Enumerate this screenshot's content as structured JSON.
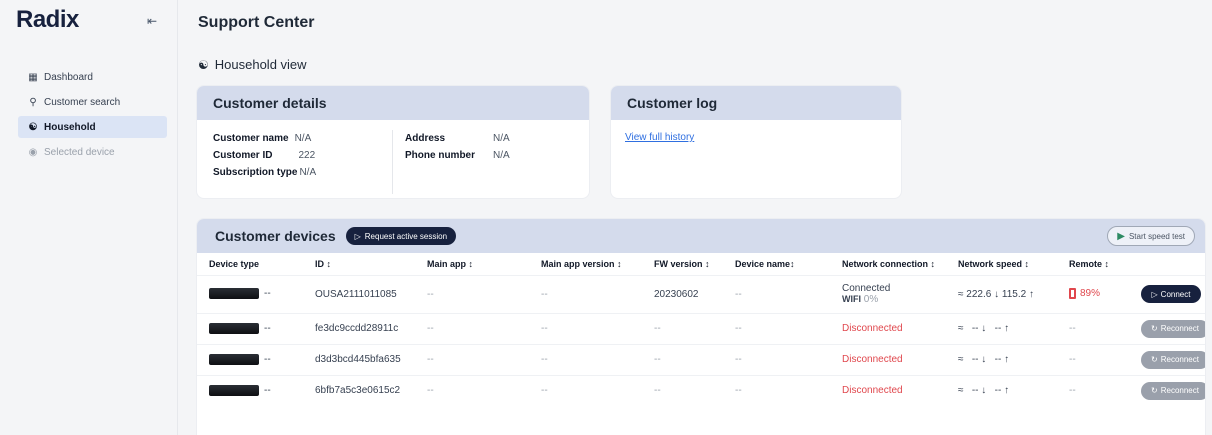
{
  "brand": "Radix",
  "sidebar": {
    "items": [
      {
        "label": "Dashboard",
        "icon": "grid-icon"
      },
      {
        "label": "Customer search",
        "icon": "search-icon"
      },
      {
        "label": "Household",
        "icon": "household-icon",
        "active": true
      },
      {
        "label": "Selected device",
        "icon": "device-icon",
        "disabled": true
      }
    ]
  },
  "header": {
    "title": "Support Center"
  },
  "section": {
    "title": "Household view"
  },
  "customer_details": {
    "title": "Customer details",
    "name_label": "Customer name",
    "name_value": "N/A",
    "id_label": "Customer ID",
    "id_value": "222",
    "subscription_label": "Subscription type",
    "subscription_value": "N/A",
    "address_label": "Address",
    "address_value": "N/A",
    "phone_label": "Phone number",
    "phone_value": "N/A"
  },
  "customer_log": {
    "title": "Customer log",
    "link": "View full history"
  },
  "devices": {
    "title": "Customer devices",
    "request_session": "Request active session",
    "speed_test": "Start speed test",
    "columns": [
      "Device type",
      "ID ↕",
      "Main app ↕",
      "Main app version ↕",
      "FW version ↕",
      "Device name↕",
      "Network connection ↕",
      "Network speed ↕",
      "Remote ↕"
    ],
    "rows": [
      {
        "type": "--",
        "id": "OUSA2111011085",
        "main_app": "--",
        "main_app_version": "--",
        "fw": "20230602",
        "name": "--",
        "conn": "Connected",
        "conn_sub": "WIFI",
        "conn_pct": "0%",
        "down": "222.6",
        "up": "115.2",
        "remote": "89%",
        "action": "Connect"
      },
      {
        "type": "--",
        "id": "fe3dc9ccdd28911c",
        "main_app": "--",
        "main_app_version": "--",
        "fw": "--",
        "name": "--",
        "conn": "Disconnected",
        "down": "--",
        "up": "--",
        "remote": "--",
        "action": "Reconnect"
      },
      {
        "type": "--",
        "id": "d3d3bcd445bfa635",
        "main_app": "--",
        "main_app_version": "--",
        "fw": "--",
        "name": "--",
        "conn": "Disconnected",
        "down": "--",
        "up": "--",
        "remote": "--",
        "action": "Reconnect"
      },
      {
        "type": "--",
        "id": "6bfb7a5c3e0615c2",
        "main_app": "--",
        "main_app_version": "--",
        "fw": "--",
        "name": "--",
        "conn": "Disconnected",
        "down": "--",
        "up": "--",
        "remote": "--",
        "action": "Reconnect"
      }
    ]
  },
  "colors": {
    "accent": "#17213e",
    "header_bg": "#d4dbec",
    "error": "#e0474d",
    "link": "#2f6fe0"
  }
}
